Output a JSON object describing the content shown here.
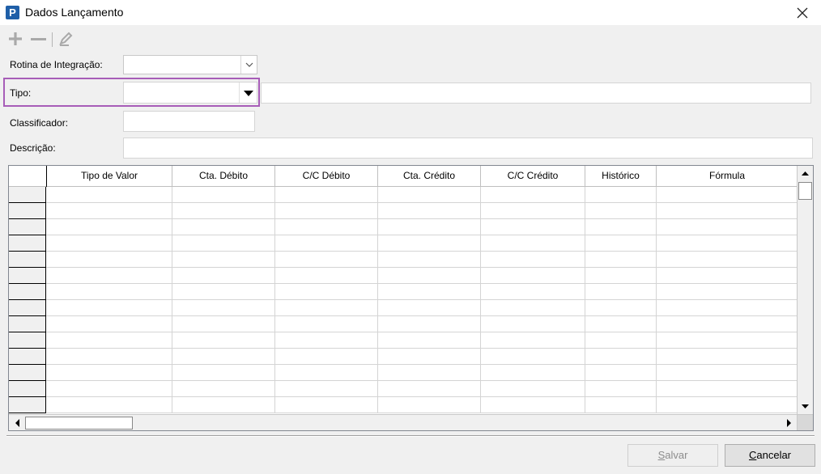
{
  "window": {
    "title": "Dados Lançamento",
    "app_icon_letter": "P"
  },
  "toolbar": {
    "add_icon": "plus-icon",
    "remove_icon": "minus-icon",
    "edit_icon": "pencil-icon"
  },
  "form": {
    "rotina_label": "Rotina de Integração:",
    "rotina_value": "",
    "tipo_label": "Tipo:",
    "tipo_value": "",
    "tipo_description": "",
    "classificador_label": "Classificador:",
    "classificador_value": "",
    "descricao_label": "Descrição:",
    "descricao_value": "",
    "highlight_color": "#a75db8"
  },
  "grid": {
    "columns": [
      "Tipo de Valor",
      "Cta. Débito",
      "C/C Débito",
      "Cta. Crédito",
      "C/C Crédito",
      "Histórico",
      "Fórmula"
    ],
    "rows": [
      [
        "",
        "",
        "",
        "",
        "",
        "",
        ""
      ],
      [
        "",
        "",
        "",
        "",
        "",
        "",
        ""
      ],
      [
        "",
        "",
        "",
        "",
        "",
        "",
        ""
      ],
      [
        "",
        "",
        "",
        "",
        "",
        "",
        ""
      ],
      [
        "",
        "",
        "",
        "",
        "",
        "",
        ""
      ],
      [
        "",
        "",
        "",
        "",
        "",
        "",
        ""
      ],
      [
        "",
        "",
        "",
        "",
        "",
        "",
        ""
      ],
      [
        "",
        "",
        "",
        "",
        "",
        "",
        ""
      ],
      [
        "",
        "",
        "",
        "",
        "",
        "",
        ""
      ],
      [
        "",
        "",
        "",
        "",
        "",
        "",
        ""
      ],
      [
        "",
        "",
        "",
        "",
        "",
        "",
        ""
      ],
      [
        "",
        "",
        "",
        "",
        "",
        "",
        ""
      ],
      [
        "",
        "",
        "",
        "",
        "",
        "",
        ""
      ],
      [
        "",
        "",
        "",
        "",
        "",
        "",
        ""
      ]
    ]
  },
  "buttons": {
    "save_mnemonic": "S",
    "save_rest": "alvar",
    "cancel_mnemonic": "C",
    "cancel_rest": "ancelar"
  }
}
